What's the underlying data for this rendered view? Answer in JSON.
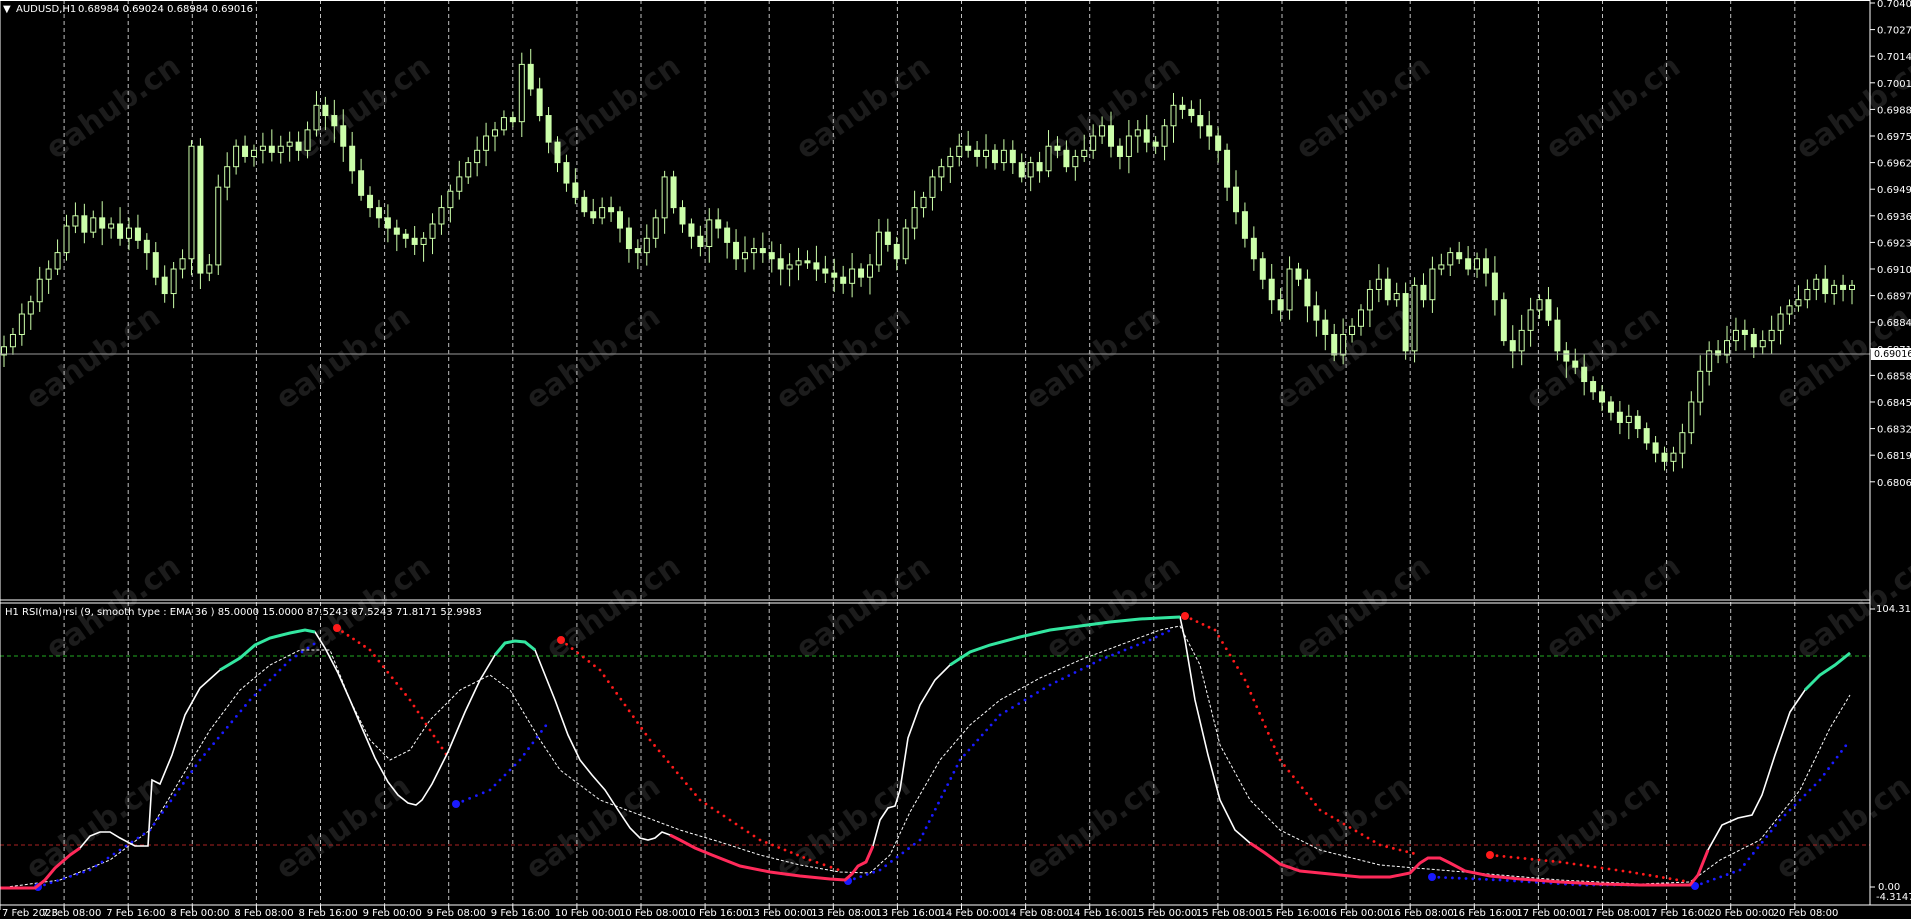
{
  "main_header": {
    "arrow": "▼",
    "symbol": "AUDUSD,H1",
    "ohlc": "0.68984 0.69024 0.68984 0.69016"
  },
  "price_axis": [
    "0.70400",
    "0.70270",
    "0.70140",
    "0.70010",
    "0.69880",
    "0.69750",
    "0.69620",
    "0.69490",
    "0.69360",
    "0.69230",
    "0.69100",
    "0.68970",
    "0.68840",
    "0.68710",
    "0.68580",
    "0.68450",
    "0.68320",
    "0.68190",
    "0.68060"
  ],
  "current_price": "0.69016",
  "indicator_header": "H1 RSI(ma) rsi (9, smooth type : EMA  36 ) 85.0000 15.0000 87.5243 87.5243 71.8171 52.9983",
  "indicator_axis": {
    "top": "104.3164",
    "zero": "0.00",
    "bottom": "-4.3147"
  },
  "time_axis": [
    "7 Feb 2023",
    "7 Feb 08:00",
    "7 Feb 16:00",
    "8 Feb 00:00",
    "8 Feb 08:00",
    "8 Feb 16:00",
    "9 Feb 00:00",
    "9 Feb 08:00",
    "9 Feb 16:00",
    "10 Feb 00:00",
    "10 Feb 08:00",
    "10 Feb 16:00",
    "13 Feb 00:00",
    "13 Feb 08:00",
    "13 Feb 16:00",
    "14 Feb 00:00",
    "14 Feb 08:00",
    "14 Feb 16:00",
    "15 Feb 00:00",
    "15 Feb 08:00",
    "15 Feb 16:00",
    "16 Feb 00:00",
    "16 Feb 08:00",
    "16 Feb 16:00",
    "17 Feb 00:00",
    "17 Feb 08:00",
    "17 Feb 16:00",
    "20 Feb 00:00",
    "20 Feb 08:00"
  ],
  "watermark": "eahub.cn",
  "colors": {
    "background": "#000000",
    "candle": "#ccffaa",
    "candle_dark": "#1a7a1a",
    "grid": "#c0c0c0",
    "rsi_line": "#ffffff",
    "rsi_bull": "#33e6a0",
    "rsi_bear": "#ff2a5a",
    "dot_red": "#ff1a1a",
    "dot_blue": "#1a1aff",
    "level_up": "#22aa22",
    "level_down": "#aa2222"
  },
  "chart_data": {
    "type": "candlestick",
    "symbol": "AUDUSD",
    "timeframe": "H1",
    "ylim": [
      0.6806,
      0.704
    ],
    "close_path": [
      0.6872,
      0.6878,
      0.6888,
      0.6894,
      0.6905,
      0.691,
      0.6918,
      0.6931,
      0.6936,
      0.6928,
      0.6935,
      0.693,
      0.6932,
      0.6925,
      0.693,
      0.6924,
      0.6918,
      0.6906,
      0.6898,
      0.691,
      0.6915,
      0.697,
      0.6908,
      0.6912,
      0.695,
      0.696,
      0.697,
      0.6965,
      0.6968,
      0.697,
      0.6967,
      0.697,
      0.6972,
      0.6968,
      0.6978,
      0.699,
      0.6985,
      0.698,
      0.697,
      0.6958,
      0.6946,
      0.694,
      0.6935,
      0.693,
      0.6927,
      0.6925,
      0.6922,
      0.6925,
      0.6932,
      0.694,
      0.6948,
      0.6955,
      0.6962,
      0.6968,
      0.6975,
      0.6978,
      0.6984,
      0.6982,
      0.701,
      0.6998,
      0.6985,
      0.6972,
      0.6962,
      0.6952,
      0.6945,
      0.6938,
      0.6935,
      0.694,
      0.6938,
      0.693,
      0.692,
      0.6918,
      0.6925,
      0.6935,
      0.6955,
      0.694,
      0.6932,
      0.6926,
      0.6921,
      0.6934,
      0.693,
      0.6923,
      0.6915,
      0.6918,
      0.692,
      0.6918,
      0.6915,
      0.691,
      0.6912,
      0.6914,
      0.6913,
      0.691,
      0.6908,
      0.6906,
      0.6903,
      0.691,
      0.6906,
      0.6912,
      0.6928,
      0.6922,
      0.6915,
      0.693,
      0.694,
      0.6945,
      0.6955,
      0.696,
      0.6965,
      0.697,
      0.6968,
      0.6965,
      0.6968,
      0.6962,
      0.6968,
      0.6962,
      0.6955,
      0.6962,
      0.6958,
      0.697,
      0.6968,
      0.696,
      0.6965,
      0.6968,
      0.6975,
      0.698,
      0.697,
      0.6965,
      0.6975,
      0.6978,
      0.6972,
      0.697,
      0.698,
      0.699,
      0.6988,
      0.6985,
      0.698,
      0.6975,
      0.6968,
      0.695,
      0.6938,
      0.6925,
      0.6915,
      0.6905,
      0.6895,
      0.689,
      0.691,
      0.6905,
      0.6892,
      0.6885,
      0.6878,
      0.6868,
      0.6878,
      0.6882,
      0.689,
      0.69,
      0.6905,
      0.6895,
      0.6898,
      0.687,
      0.6902,
      0.6895,
      0.691,
      0.6912,
      0.6918,
      0.6915,
      0.691,
      0.6915,
      0.6908,
      0.6895,
      0.6875,
      0.687,
      0.688,
      0.689,
      0.6895,
      0.6885,
      0.687,
      0.6865,
      0.6862,
      0.6855,
      0.685,
      0.6845,
      0.684,
      0.6835,
      0.6838,
      0.6832,
      0.6825,
      0.682,
      0.6816,
      0.682,
      0.683,
      0.6845,
      0.686,
      0.687,
      0.6868,
      0.6875,
      0.688,
      0.6878,
      0.6872,
      0.6875,
      0.688,
      0.6888,
      0.6892,
      0.6895,
      0.69,
      0.6905,
      0.6898,
      0.6902,
      0.69,
      0.6902
    ]
  }
}
